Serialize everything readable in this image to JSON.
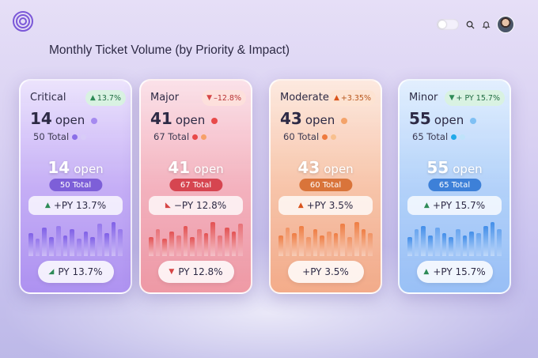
{
  "page": {
    "title": "Monthly Ticket Volume (by Priority & Impact)"
  },
  "header": {
    "logo_icon": "concentric-circles-logo-icon",
    "toggle_icon": "theme-toggle-icon",
    "search_icon": "search-icon",
    "bell_icon": "bell-icon",
    "avatar": "user-avatar"
  },
  "cards": [
    {
      "label": "Critical",
      "change": "13.7%",
      "change_direction": "up",
      "open_num": "14",
      "open_label": "open",
      "total": "50 Total",
      "center_num": "14",
      "center_label": "open",
      "pill_total": "50 Total",
      "py_chip": "+PY 13.7%",
      "footer": "PY 13.7%",
      "accent": "#7c5ce6",
      "bars": [
        0.6,
        0.45,
        0.75,
        0.5,
        0.8,
        0.55,
        0.7,
        0.45,
        0.65,
        0.5,
        0.85,
        0.6,
        0.9,
        0.7
      ]
    },
    {
      "label": "Major",
      "change": "–12.8%",
      "change_direction": "down",
      "open_num": "41",
      "open_label": "open",
      "total": "67 Total",
      "center_num": "41",
      "center_label": "open",
      "pill_total": "67 Total",
      "py_chip": "−PY 12.8%",
      "footer": "PY 12.8%",
      "accent": "#e24d4d",
      "bars": [
        0.5,
        0.7,
        0.45,
        0.65,
        0.55,
        0.8,
        0.5,
        0.7,
        0.6,
        0.9,
        0.55,
        0.75,
        0.65,
        0.85
      ]
    },
    {
      "label": "Moderate",
      "change": "+3.35%",
      "change_direction": "up",
      "open_num": "43",
      "open_label": "open",
      "total": "60 Total",
      "center_num": "43",
      "center_label": "open",
      "pill_total": "60 Total",
      "py_chip": "+PY 3.5%",
      "footer": "+PY 3.5%",
      "accent": "#ee7a3e",
      "bars": [
        0.55,
        0.75,
        0.6,
        0.8,
        0.5,
        0.7,
        0.55,
        0.65,
        0.6,
        0.85,
        0.5,
        0.9,
        0.7,
        0.6
      ]
    },
    {
      "label": "Minor",
      "change": "+ PY 15.7%",
      "change_direction": "up",
      "open_num": "55",
      "open_label": "open",
      "total": "65 Total",
      "center_num": "55",
      "center_label": "open",
      "pill_total": "65 Total",
      "py_chip": "+PY  15.7%",
      "footer": "+PY 15.7%",
      "accent": "#3d8be8",
      "bars": [
        0.5,
        0.7,
        0.8,
        0.55,
        0.75,
        0.6,
        0.5,
        0.7,
        0.55,
        0.65,
        0.6,
        0.8,
        0.9,
        0.7
      ]
    }
  ]
}
